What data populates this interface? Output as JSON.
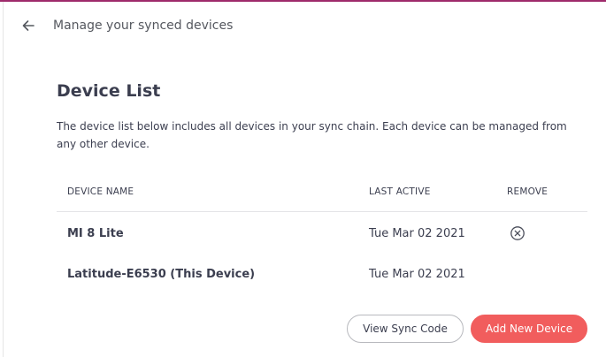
{
  "header": {
    "back_icon": "arrow-left-icon",
    "title": "Manage your synced devices"
  },
  "main": {
    "heading": "Device List",
    "description": "The device list below includes all devices in your sync chain. Each device can be managed from any other device."
  },
  "table": {
    "columns": {
      "name": "DEVICE NAME",
      "last_active": "LAST ACTIVE",
      "remove": "REMOVE"
    },
    "rows": [
      {
        "name": "MI 8 Lite",
        "last_active": "Tue Mar 02 2021",
        "removable": true
      },
      {
        "name": "Latitude-E6530 (This Device)",
        "last_active": "Tue Mar 02 2021",
        "removable": false
      }
    ]
  },
  "actions": {
    "view_sync_code": "View Sync Code",
    "add_new_device": "Add New Device"
  },
  "colors": {
    "accent_top_border": "#9e2a6b",
    "primary_button": "#f15d5d",
    "text": "#3b3e4f"
  }
}
